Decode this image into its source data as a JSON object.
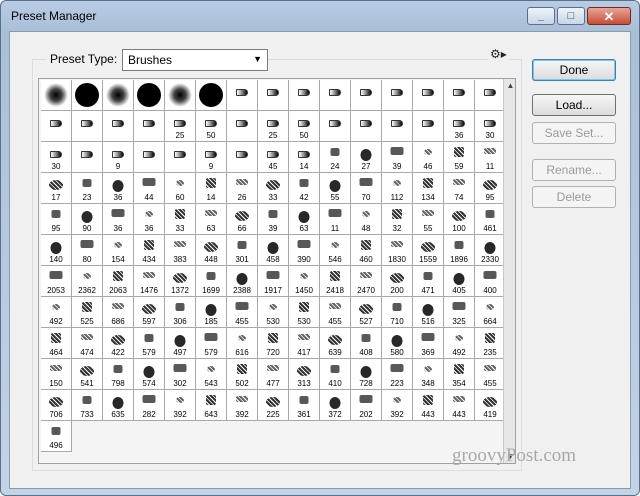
{
  "window": {
    "title": "Preset Manager"
  },
  "preset_type": {
    "label": "Preset Type:",
    "value": "Brushes"
  },
  "buttons": {
    "done": "Done",
    "load": "Load...",
    "save_set": "Save Set...",
    "rename": "Rename...",
    "delete": "Delete"
  },
  "brush_cells": [
    "",
    "",
    "",
    "",
    "",
    "",
    "",
    "",
    "",
    "",
    "",
    "",
    "",
    "",
    "",
    "",
    "",
    "",
    "",
    "25",
    "50",
    "",
    "25",
    "50",
    "",
    "",
    "",
    "",
    "36",
    "30",
    "30",
    "",
    "9",
    "",
    "",
    "9",
    "",
    "45",
    "14",
    "24",
    "27",
    "39",
    "46",
    "59",
    "11",
    "17",
    "23",
    "36",
    "44",
    "60",
    "14",
    "26",
    "33",
    "42",
    "55",
    "70",
    "112",
    "134",
    "74",
    "95",
    "95",
    "90",
    "36",
    "36",
    "33",
    "63",
    "66",
    "39",
    "63",
    "11",
    "48",
    "32",
    "55",
    "100",
    "461",
    "140",
    "80",
    "154",
    "434",
    "383",
    "448",
    "301",
    "458",
    "390",
    "546",
    "460",
    "1830",
    "1559",
    "1896",
    "2330",
    "2053",
    "2362",
    "2063",
    "1476",
    "1372",
    "1699",
    "2388",
    "1917",
    "1450",
    "2418",
    "2470",
    "200",
    "471",
    "405",
    "400",
    "492",
    "525",
    "686",
    "597",
    "306",
    "185",
    "455",
    "530",
    "530",
    "455",
    "527",
    "710",
    "516",
    "325",
    "664",
    "464",
    "474",
    "422",
    "579",
    "497",
    "579",
    "616",
    "720",
    "417",
    "639",
    "408",
    "580",
    "369",
    "492",
    "235",
    "150",
    "541",
    "798",
    "574",
    "302",
    "543",
    "502",
    "477",
    "313",
    "410",
    "728",
    "223",
    "348",
    "354",
    "455",
    "706",
    "733",
    "635",
    "282",
    "392",
    "643",
    "392",
    "225",
    "361",
    "372",
    "202",
    "392",
    "443",
    "443",
    "419",
    "496"
  ],
  "watermark": "groovyPost.com"
}
